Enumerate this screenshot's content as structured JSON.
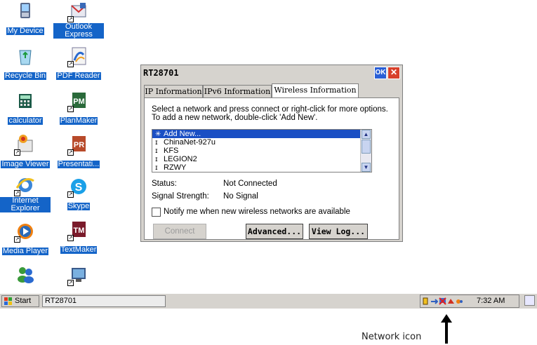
{
  "desktop": {
    "icons": [
      {
        "label": "My Device"
      },
      {
        "label": "Outlook Express"
      },
      {
        "label": "Recycle Bin"
      },
      {
        "label": "PDF Reader"
      },
      {
        "label": "calculator"
      },
      {
        "label": "PlanMaker"
      },
      {
        "label": "Image Viewer"
      },
      {
        "label": "Presentati..."
      },
      {
        "label": "Internet Explorer"
      },
      {
        "label": "Skype"
      },
      {
        "label": "Media Player"
      },
      {
        "label": "TextMaker"
      }
    ]
  },
  "dialog": {
    "title": "RT28701",
    "ok_label": "OK",
    "close_label": "✕",
    "tabs": [
      {
        "label": "IP Information"
      },
      {
        "label": "IPv6 Information"
      },
      {
        "label": "Wireless Information"
      }
    ],
    "instructions": "Select a network and press connect or right-click for more options.  To add a new network, double-click 'Add New'.",
    "networks": [
      {
        "name": "Add New..."
      },
      {
        "name": "ChinaNet-927u"
      },
      {
        "name": "KFS"
      },
      {
        "name": "LEGION2"
      },
      {
        "name": "RZWY"
      }
    ],
    "status_label": "Status:",
    "status_value": "Not Connected",
    "signal_label": "Signal Strength:",
    "signal_value": "No Signal",
    "notify_label": "Notify me when new wireless networks are available",
    "connect_label": "Connect",
    "advanced_label": "Advanced...",
    "viewlog_label": "View Log..."
  },
  "taskbar": {
    "start_label": "Start",
    "task_label": "RT28701",
    "clock": "7:32 AM"
  },
  "annotation": {
    "text": "Network icon"
  }
}
